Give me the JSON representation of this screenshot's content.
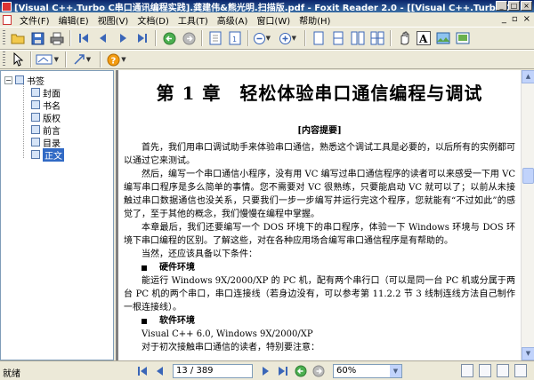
{
  "window": {
    "title": "[Visual C++.Turbo C串口通讯编程实践].龚建伟&熊光明.扫描版.pdf - Foxit Reader 2.0 - [[Visual C++.Turbo C"
  },
  "menu": {
    "items": [
      {
        "label": "文件(F)"
      },
      {
        "label": "编辑(E)"
      },
      {
        "label": "视图(V)"
      },
      {
        "label": "文档(D)"
      },
      {
        "label": "工具(T)"
      },
      {
        "label": "高级(A)"
      },
      {
        "label": "窗口(W)"
      },
      {
        "label": "帮助(H)"
      }
    ]
  },
  "bookmarks": {
    "root_label": "书签",
    "expander": "−",
    "items": [
      {
        "label": "封面"
      },
      {
        "label": "书名"
      },
      {
        "label": "版权"
      },
      {
        "label": "前言"
      },
      {
        "label": "目录"
      },
      {
        "label": "正文"
      }
    ],
    "selected_index": 5
  },
  "document": {
    "chapter_title": "第 1 章　轻松体验串口通信编程与调试",
    "summary_heading": "[内容提要]",
    "paragraphs": [
      "首先，我们用串口调试助手来体验串口通信，熟悉这个调试工具是必要的，以后所有的实例都可以通过它来测试。",
      "然后，编写一个串口通信小程序，没有用 VC 编写过串口通信程序的读者可以来感受一下用 VC 编写串口程序是多么简单的事情。您不需要对 VC 很熟练，只要能启动 VC 就可以了；以前从未接触过串口数据通信也没关系，只要我们一步一步编写并运行完这个程序，您就能有“不过如此”的感觉了，至于其他的概念，我们慢慢在编程中掌握。",
      "本章最后，我们还要编写一个 DOS 环境下的串口程序，体验一下 Windows 环境与 DOS 环境下串口编程的区别。了解这些，对在各种应用场合编写串口通信程序是有帮助的。",
      "当然，还应该具备以下条件："
    ],
    "hardware_heading": "硬件环境",
    "hardware_text": "能运行 Windows 9X/2000/XP 的 PC 机，配有两个串行口（可以是同一台 PC 机或分属于两台 PC 机的两个串口，串口连接线（若身边没有，可以参考第 11.2.2 节 3 线制连线方法自己制作一根连接线）。",
    "software_heading": "软件环境",
    "software_text": "Visual C++ 6.0, Windows 9X/2000/XP",
    "last_text": "对于初次接触串口通信的读者，特别要注意："
  },
  "status": {
    "text": "就绪",
    "page_value": "13 / 389",
    "zoom_value": "60%"
  },
  "colors": {
    "titlebar": "#0a246a",
    "selection": "#316ac5",
    "toolbar_bg": "#ece9d8"
  }
}
